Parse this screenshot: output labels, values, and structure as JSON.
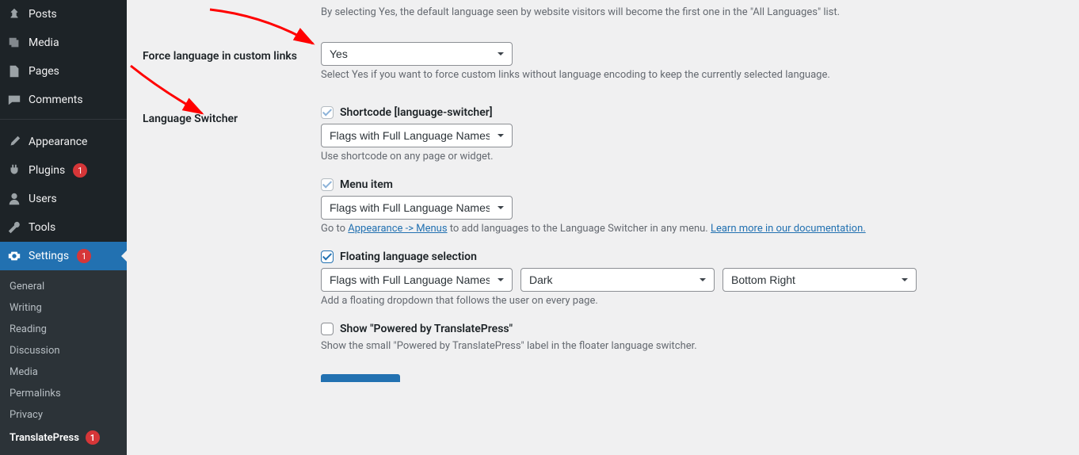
{
  "sidebar": {
    "items": [
      {
        "icon": "pin-icon",
        "label": "Posts"
      },
      {
        "icon": "media-icon",
        "label": "Media"
      },
      {
        "icon": "page-icon",
        "label": "Pages"
      },
      {
        "icon": "comment-icon",
        "label": "Comments"
      }
    ],
    "second_group": [
      {
        "icon": "brush-icon",
        "label": "Appearance"
      },
      {
        "icon": "plug-icon",
        "label": "Plugins",
        "badge": "1"
      },
      {
        "icon": "users-icon",
        "label": "Users"
      },
      {
        "icon": "wrench-icon",
        "label": "Tools"
      },
      {
        "icon": "settings-icon",
        "label": "Settings",
        "badge": "1",
        "current": true
      }
    ],
    "submenu": [
      {
        "label": "General"
      },
      {
        "label": "Writing"
      },
      {
        "label": "Reading"
      },
      {
        "label": "Discussion"
      },
      {
        "label": "Media"
      },
      {
        "label": "Permalinks"
      },
      {
        "label": "Privacy"
      },
      {
        "label": "TranslatePress",
        "badge": "1",
        "current": true
      }
    ]
  },
  "content": {
    "prev_desc": "By selecting Yes, the default language seen by website visitors will become the first one in the \"All Languages\" list.",
    "force_links": {
      "label": "Force language in custom links",
      "value": "Yes",
      "desc": "Select Yes if you want to force custom links without language encoding to keep the currently selected language."
    },
    "switcher": {
      "label": "Language Switcher",
      "shortcode": {
        "checked": true,
        "label": "Shortcode [language-switcher]",
        "select": "Flags with Full Language Names",
        "desc": "Use shortcode on any page or widget."
      },
      "menu_item": {
        "checked": true,
        "label": "Menu item",
        "select": "Flags with Full Language Names",
        "desc_pre": "Go to ",
        "link1": "Appearance -> Menus",
        "desc_mid": " to add languages to the Language Switcher in any menu. ",
        "link2": "Learn more in our documentation."
      },
      "floating": {
        "checked": true,
        "label": "Floating language selection",
        "select_style": "Flags with Full Language Names",
        "select_theme": "Dark",
        "select_pos": "Bottom Right",
        "desc": "Add a floating dropdown that follows the user on every page."
      },
      "powered": {
        "checked": false,
        "label": "Show \"Powered by TranslatePress\"",
        "desc": "Show the small \"Powered by TranslatePress\" label in the floater language switcher."
      }
    }
  }
}
